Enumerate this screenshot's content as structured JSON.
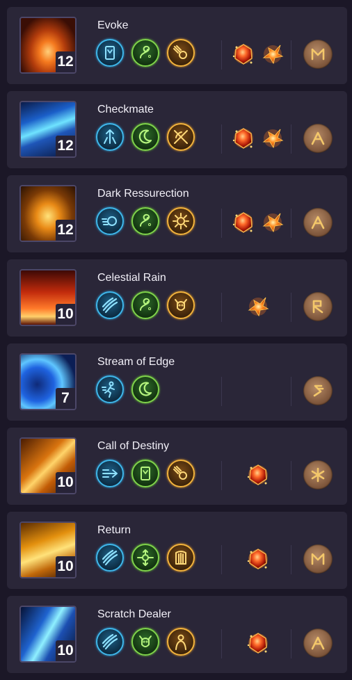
{
  "colors": {
    "background": "#1b1727",
    "card": "#2a2638",
    "rune_blue": "#3fb7ea",
    "rune_green": "#7fd34a",
    "rune_gold": "#f2b33c",
    "gem": "#e8491f",
    "stone": "#9c6f4f"
  },
  "skills": [
    {
      "name": "Evoke",
      "level": "12",
      "art": "evoke-art",
      "runes": [
        {
          "color": "blue",
          "icon": "card-icon"
        },
        {
          "color": "green",
          "icon": "spiral-hand-icon"
        },
        {
          "color": "gold",
          "icon": "comet-icon"
        }
      ],
      "gems": [
        "ruby-gem-icon",
        "fire-shard-icon"
      ],
      "stone": "m-rune-icon"
    },
    {
      "name": "Checkmate",
      "level": "12",
      "art": "checkmate-art",
      "runes": [
        {
          "color": "blue",
          "icon": "upward-burst-icon"
        },
        {
          "color": "green",
          "icon": "crescent-moon-icon"
        },
        {
          "color": "gold",
          "icon": "crossed-bow-icon"
        }
      ],
      "gems": [
        "ruby-gem-icon",
        "fire-shard-icon"
      ],
      "stone": "a-rune-icon"
    },
    {
      "name": "Dark Ressurection",
      "level": "12",
      "art": "dark-ressurection-art",
      "runes": [
        {
          "color": "blue",
          "icon": "dash-orb-icon"
        },
        {
          "color": "green",
          "icon": "spiral-hand-icon"
        },
        {
          "color": "gold",
          "icon": "sun-burst-icon"
        }
      ],
      "gems": [
        "ruby-gem-icon",
        "fire-shard-icon"
      ],
      "stone": "a-rune-icon"
    },
    {
      "name": "Celestial Rain",
      "level": "10",
      "art": "celestial-rain-art",
      "runes": [
        {
          "color": "blue",
          "icon": "claw-slash-icon"
        },
        {
          "color": "green",
          "icon": "spiral-hand-icon"
        },
        {
          "color": "gold",
          "icon": "beast-head-icon"
        }
      ],
      "gems": [
        "fire-shard-icon"
      ],
      "stone": "r-rune-icon"
    },
    {
      "name": "Stream of Edge",
      "level": "7",
      "art": "stream-of-edge-art",
      "runes": [
        {
          "color": "blue",
          "icon": "running-figure-icon"
        },
        {
          "color": "green",
          "icon": "crescent-moon-icon"
        }
      ],
      "gems": [],
      "stone": "s-rune-icon"
    },
    {
      "name": "Call of Destiny",
      "level": "10",
      "art": "call-of-destiny-art",
      "runes": [
        {
          "color": "blue",
          "icon": "speed-arrow-icon"
        },
        {
          "color": "green",
          "icon": "card-icon"
        },
        {
          "color": "gold",
          "icon": "comet-icon"
        }
      ],
      "gems": [
        "ruby-gem-icon"
      ],
      "stone": "asterisk-rune-icon"
    },
    {
      "name": "Return",
      "level": "10",
      "art": "return-art",
      "runes": [
        {
          "color": "blue",
          "icon": "claw-slash-icon"
        },
        {
          "color": "green",
          "icon": "compass-arrows-icon"
        },
        {
          "color": "gold",
          "icon": "harp-icon"
        }
      ],
      "gems": [
        "ruby-gem-icon"
      ],
      "stone": "m-rune-icon"
    },
    {
      "name": "Scratch Dealer",
      "level": "10",
      "art": "scratch-dealer-art",
      "runes": [
        {
          "color": "blue",
          "icon": "claw-slash-icon"
        },
        {
          "color": "green",
          "icon": "beast-head-icon"
        },
        {
          "color": "gold",
          "icon": "figure-silhouette-icon"
        }
      ],
      "gems": [
        "ruby-gem-icon"
      ],
      "stone": "a-rune-icon"
    }
  ]
}
